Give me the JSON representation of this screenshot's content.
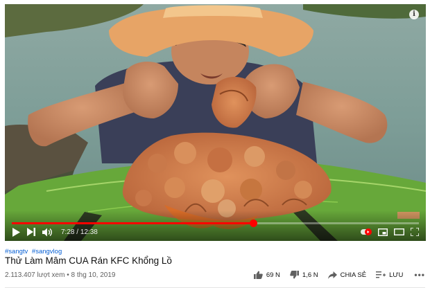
{
  "player": {
    "current_time": "7:28",
    "duration": "12:38",
    "progress_fraction": 0.592
  },
  "video": {
    "hashtags": [
      "#sangtv",
      "#sangvlog"
    ],
    "title": "Thử Làm Mâm CUA Rán KFC Khổng Lồ",
    "views": "2.113.407 lượt xem",
    "separator": "•",
    "date": "8 thg 10, 2019"
  },
  "actions": {
    "like_count": "69 N",
    "dislike_count": "1,6 N",
    "share_label": "CHIA SẺ",
    "save_label": "LƯU"
  },
  "icons": [
    "info-icon",
    "play-icon",
    "next-icon",
    "volume-icon",
    "autoplay-icon",
    "miniplayer-icon",
    "theater-icon",
    "fullscreen-icon",
    "like-icon",
    "dislike-icon",
    "share-icon",
    "save-icon",
    "more-icon"
  ],
  "colors": {
    "progress": "#ff0000",
    "hashtag": "#065fd4"
  }
}
